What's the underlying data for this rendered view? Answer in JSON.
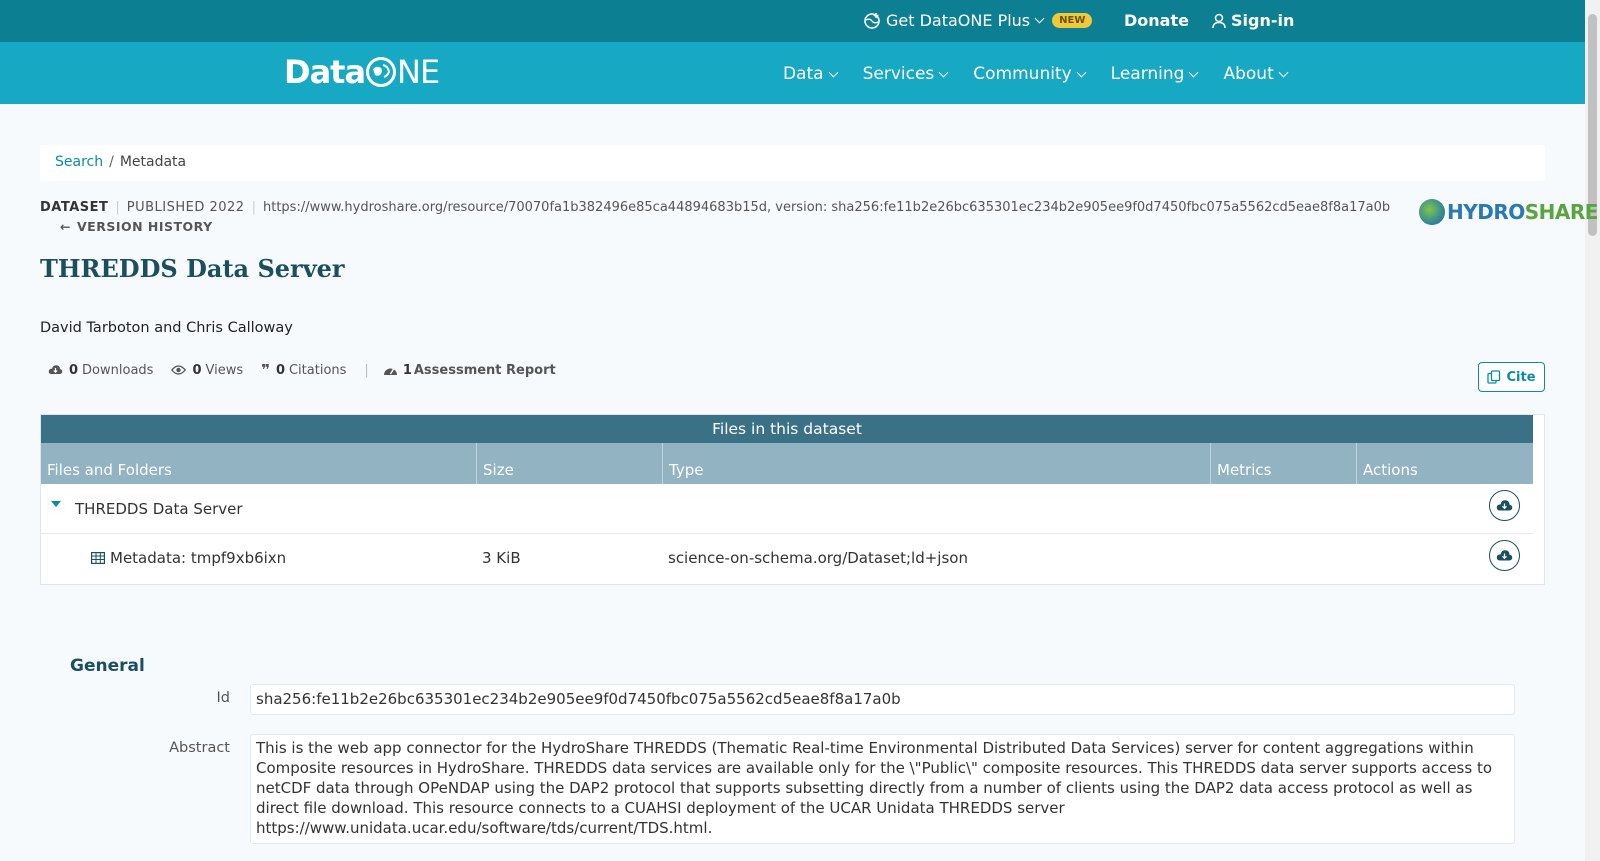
{
  "topbar": {
    "plus_label": "Get DataONE Plus",
    "new_badge": "NEW",
    "donate": "Donate",
    "signin": "Sign-in"
  },
  "logo": {
    "left": "Data",
    "right": "NE"
  },
  "nav": [
    {
      "label": "Data"
    },
    {
      "label": "Services"
    },
    {
      "label": "Community"
    },
    {
      "label": "Learning"
    },
    {
      "label": "About"
    }
  ],
  "breadcrumb": {
    "search": "Search",
    "sep": "/",
    "current": "Metadata"
  },
  "dataset": {
    "type": "DATASET",
    "published": "PUBLISHED 2022",
    "identifier": "https://www.hydroshare.org/resource/70070fa1b382496e85ca44894683b15d, version: sha256:fe11b2e26bc635301ec234b2e905ee9f0d7450fbc075a5562cd5eae8f8a17a0b",
    "version_history": "VERSION HISTORY",
    "repo_logo_a": "HYDRO",
    "repo_logo_b": "SHARE",
    "title": "THREDDS Data Server",
    "authors": "David Tarboton and Chris Calloway"
  },
  "stats": {
    "downloads_count": "0",
    "downloads_label": "Downloads",
    "views_count": "0",
    "views_label": "Views",
    "citations_count": "0",
    "citations_label": "Citations",
    "assessment_count": "1",
    "assessment_label": "Assessment Report",
    "cite_label": "Cite"
  },
  "files": {
    "title": "Files in this dataset",
    "columns": [
      "Files and Folders",
      "Size",
      "Type",
      "Metrics",
      "Actions"
    ],
    "folder": {
      "name": "THREDDS Data Server"
    },
    "rows": [
      {
        "name": "Metadata: tmpf9xb6ixn",
        "size": "3 KiB",
        "type": "science-on-schema.org/Dataset;ld+json"
      }
    ]
  },
  "general": {
    "section_title": "General",
    "id_label": "Id",
    "id_value": "sha256:fe11b2e26bc635301ec234b2e905ee9f0d7450fbc075a5562cd5eae8f8a17a0b",
    "abstract_label": "Abstract",
    "abstract_value": "This is the web app connector for the HydroShare THREDDS (Thematic Real-time Environmental Distributed Data Services) server for content aggregations within Composite resources in HydroShare. THREDDS data services are available only for the \\\"Public\\\" composite resources. This THREDDS data server supports access to netCDF data through OPeNDAP using the DAP2 protocol that supports subsetting directly from a number of clients using the DAP2 data access protocol as well as direct file download. This resource connects to a CUAHSI deployment of the UCAR Unidata THREDDS server https://www.unidata.ucar.edu/software/tds/current/TDS.html."
  },
  "colors": {
    "topbar": "#0d7f93",
    "navbar": "#17a9c3",
    "table_title": "#3b7186",
    "table_header": "#92b3c2",
    "accent": "#0d8aa3"
  }
}
